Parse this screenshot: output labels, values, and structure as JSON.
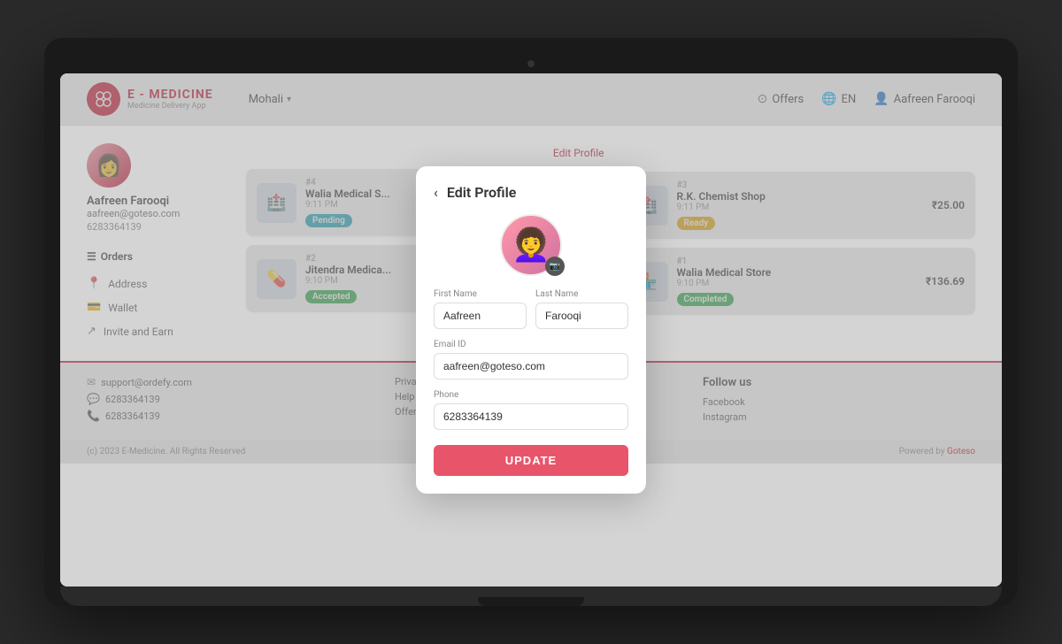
{
  "app": {
    "name": "E - MEDICINE",
    "subtitle": "Medicine Delivery App",
    "location": "Mohali",
    "camera_dot": "●"
  },
  "header": {
    "offers_label": "Offers",
    "language_label": "EN",
    "user_label": "Aafreen Farooqi"
  },
  "profile": {
    "name": "Aafreen Farooqi",
    "email": "aafreen@goteso.com",
    "phone": "6283364139",
    "edit_link": "Edit Profile"
  },
  "sidebar": {
    "orders_label": "Orders",
    "address_label": "Address",
    "wallet_label": "Wallet",
    "invite_label": "Invite and Earn"
  },
  "orders": [
    {
      "number": "#4",
      "shop": "Walia Medical S...",
      "time": "9:11 PM",
      "badge": "Pending",
      "badge_class": "pending",
      "price": ""
    },
    {
      "number": "#2",
      "shop": "Jitendra Medica...",
      "time": "9:10 PM",
      "badge": "Accepted",
      "badge_class": "accepted",
      "price": ""
    },
    {
      "number": "#3",
      "shop": "R.K. Chemist Shop",
      "time": "9:11 PM",
      "badge": "Ready",
      "badge_class": "ready",
      "price": "₹25.00"
    },
    {
      "number": "#1",
      "shop": "Walia Medical Store",
      "time": "9:10 PM",
      "badge": "Completed",
      "badge_class": "completed",
      "price": "₹136.69"
    }
  ],
  "footer": {
    "email": "support@ordefy.com",
    "phone1": "6283364139",
    "phone2": "6283364139",
    "links": [
      "Privacy Policy",
      "Help & FAQ's",
      "Offers"
    ],
    "follow_title": "Follow us",
    "social": [
      "Facebook",
      "Instagram"
    ],
    "copyright": "(c) 2023 E-Medicine. All Rights Reserved",
    "powered_by": "Powered by",
    "powered_link": "Goteso"
  },
  "modal": {
    "title": "Edit Profile",
    "back_icon": "‹",
    "camera_icon": "📷",
    "first_name_label": "First Name",
    "first_name_value": "Aafreen",
    "last_name_label": "Last Name",
    "last_name_value": "Farooqi",
    "email_label": "Email ID",
    "email_value": "aafreen@goteso.com",
    "phone_label": "Phone",
    "phone_value": "6283364139",
    "update_btn": "UPDATE"
  }
}
